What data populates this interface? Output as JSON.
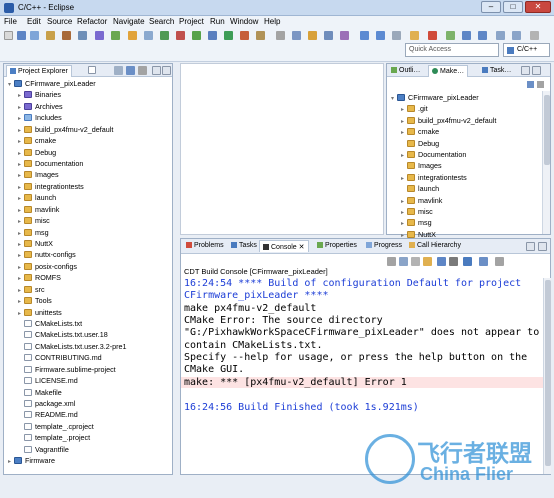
{
  "window": {
    "title": "C/C++ - Eclipse",
    "min": "–",
    "max": "□",
    "close": "✕"
  },
  "menu": [
    "File",
    "Edit",
    "Source",
    "Refactor",
    "Navigate",
    "Search",
    "Project",
    "Run",
    "Window",
    "Help"
  ],
  "quick_access": {
    "placeholder": "Quick Access"
  },
  "perspective": {
    "label": "C/C++"
  },
  "project_explorer": {
    "tab": "Project Explorer",
    "items": [
      {
        "label": "CFirmware_pixLeader",
        "type": "proj",
        "level": 0,
        "twisty": "▾"
      },
      {
        "label": "Binaries",
        "type": "binfo",
        "level": 1,
        "twisty": "▸"
      },
      {
        "label": "Archives",
        "type": "binfo",
        "level": 1,
        "twisty": "▸"
      },
      {
        "label": "Includes",
        "type": "incl",
        "level": 1,
        "twisty": "▸"
      },
      {
        "label": "build_px4fmu-v2_default",
        "type": "folder",
        "level": 1,
        "twisty": "▸"
      },
      {
        "label": "cmake",
        "type": "folder",
        "level": 1,
        "twisty": "▸"
      },
      {
        "label": "Debug",
        "type": "folder",
        "level": 1,
        "twisty": "▸"
      },
      {
        "label": "Documentation",
        "type": "folder",
        "level": 1,
        "twisty": "▸"
      },
      {
        "label": "Images",
        "type": "folder",
        "level": 1,
        "twisty": "▸"
      },
      {
        "label": "integrationtests",
        "type": "folder",
        "level": 1,
        "twisty": "▸"
      },
      {
        "label": "launch",
        "type": "folder",
        "level": 1,
        "twisty": "▸"
      },
      {
        "label": "mavlink",
        "type": "folder",
        "level": 1,
        "twisty": "▸"
      },
      {
        "label": "misc",
        "type": "folder",
        "level": 1,
        "twisty": "▸"
      },
      {
        "label": "msg",
        "type": "folder",
        "level": 1,
        "twisty": "▸"
      },
      {
        "label": "NuttX",
        "type": "folder",
        "level": 1,
        "twisty": "▸"
      },
      {
        "label": "nuttx-configs",
        "type": "folder",
        "level": 1,
        "twisty": "▸"
      },
      {
        "label": "posix-configs",
        "type": "folder",
        "level": 1,
        "twisty": "▸"
      },
      {
        "label": "ROMFS",
        "type": "folder",
        "level": 1,
        "twisty": "▸"
      },
      {
        "label": "src",
        "type": "folder",
        "level": 1,
        "twisty": "▸"
      },
      {
        "label": "Tools",
        "type": "folder",
        "level": 1,
        "twisty": "▸"
      },
      {
        "label": "unittests",
        "type": "folder",
        "level": 1,
        "twisty": "▸"
      },
      {
        "label": "CMakeLists.txt",
        "type": "file",
        "level": 1,
        "twisty": ""
      },
      {
        "label": "CMakeLists.txt.user.18",
        "type": "file",
        "level": 1,
        "twisty": ""
      },
      {
        "label": "CMakeLists.txt.user.3.2-pre1",
        "type": "file",
        "level": 1,
        "twisty": ""
      },
      {
        "label": "CONTRIBUTING.md",
        "type": "file",
        "level": 1,
        "twisty": ""
      },
      {
        "label": "Firmware.sublime-project",
        "type": "file",
        "level": 1,
        "twisty": ""
      },
      {
        "label": "LICENSE.md",
        "type": "file",
        "level": 1,
        "twisty": ""
      },
      {
        "label": "Makefile",
        "type": "file",
        "level": 1,
        "twisty": ""
      },
      {
        "label": "package.xml",
        "type": "file",
        "level": 1,
        "twisty": ""
      },
      {
        "label": "README.md",
        "type": "file",
        "level": 1,
        "twisty": ""
      },
      {
        "label": "template_.cproject",
        "type": "file",
        "level": 1,
        "twisty": ""
      },
      {
        "label": "template_.project",
        "type": "file",
        "level": 1,
        "twisty": ""
      },
      {
        "label": "Vagrantfile",
        "type": "file",
        "level": 1,
        "twisty": ""
      },
      {
        "label": "Firmware",
        "type": "proj",
        "level": 0,
        "twisty": "▸"
      }
    ]
  },
  "right_tabs": [
    "Outli…",
    "Make…",
    "Task…"
  ],
  "make_targets": {
    "items": [
      {
        "label": "CFirmware_pixLeader",
        "type": "proj",
        "level": 0,
        "twisty": "▾"
      },
      {
        "label": ".git",
        "type": "folder",
        "level": 1,
        "twisty": "▸"
      },
      {
        "label": "build_px4fmu-v2_default",
        "type": "folder",
        "level": 1,
        "twisty": "▸"
      },
      {
        "label": "cmake",
        "type": "folder",
        "level": 1,
        "twisty": "▸"
      },
      {
        "label": "Debug",
        "type": "folder",
        "level": 1,
        "twisty": ""
      },
      {
        "label": "Documentation",
        "type": "folder",
        "level": 1,
        "twisty": "▸"
      },
      {
        "label": "Images",
        "type": "folder",
        "level": 1,
        "twisty": ""
      },
      {
        "label": "integrationtests",
        "type": "folder",
        "level": 1,
        "twisty": "▸"
      },
      {
        "label": "launch",
        "type": "folder",
        "level": 1,
        "twisty": ""
      },
      {
        "label": "mavlink",
        "type": "folder",
        "level": 1,
        "twisty": "▸"
      },
      {
        "label": "misc",
        "type": "folder",
        "level": 1,
        "twisty": "▸"
      },
      {
        "label": "msg",
        "type": "folder",
        "level": 1,
        "twisty": "▸"
      },
      {
        "label": "NuttX",
        "type": "folder",
        "level": 1,
        "twisty": "▸"
      }
    ]
  },
  "bottom_tabs": [
    "Problems",
    "Tasks",
    "Console",
    "Properties",
    "Progress",
    "Call Hierarchy"
  ],
  "console": {
    "title": "CDT Build Console [CFirmware_pixLeader]",
    "lines": [
      {
        "text": "16:24:54 **** Build of configuration Default for project",
        "style": "blue"
      },
      {
        "text": "CFirmware_pixLeader ****",
        "style": "blue"
      },
      {
        "text": "make px4fmu-v2_default",
        "style": ""
      },
      {
        "text": "CMake Error: The source directory",
        "style": ""
      },
      {
        "text": "\"G:/PixhawkWorkSpaceCFirmware_pixLeader\" does not appear to",
        "style": ""
      },
      {
        "text": "contain CMakeLists.txt.",
        "style": ""
      },
      {
        "text": "Specify --help for usage, or press the help button on the",
        "style": ""
      },
      {
        "text": "CMake GUI.",
        "style": ""
      },
      {
        "text": "make: *** [px4fmu-v2_default] Error 1",
        "style": "err"
      },
      {
        "text": "",
        "style": ""
      },
      {
        "text": "16:24:56 Build Finished (took 1s.921ms)",
        "style": "blue"
      }
    ]
  },
  "watermark": {
    "cn": "飞行者联盟",
    "en": "China Flier"
  }
}
